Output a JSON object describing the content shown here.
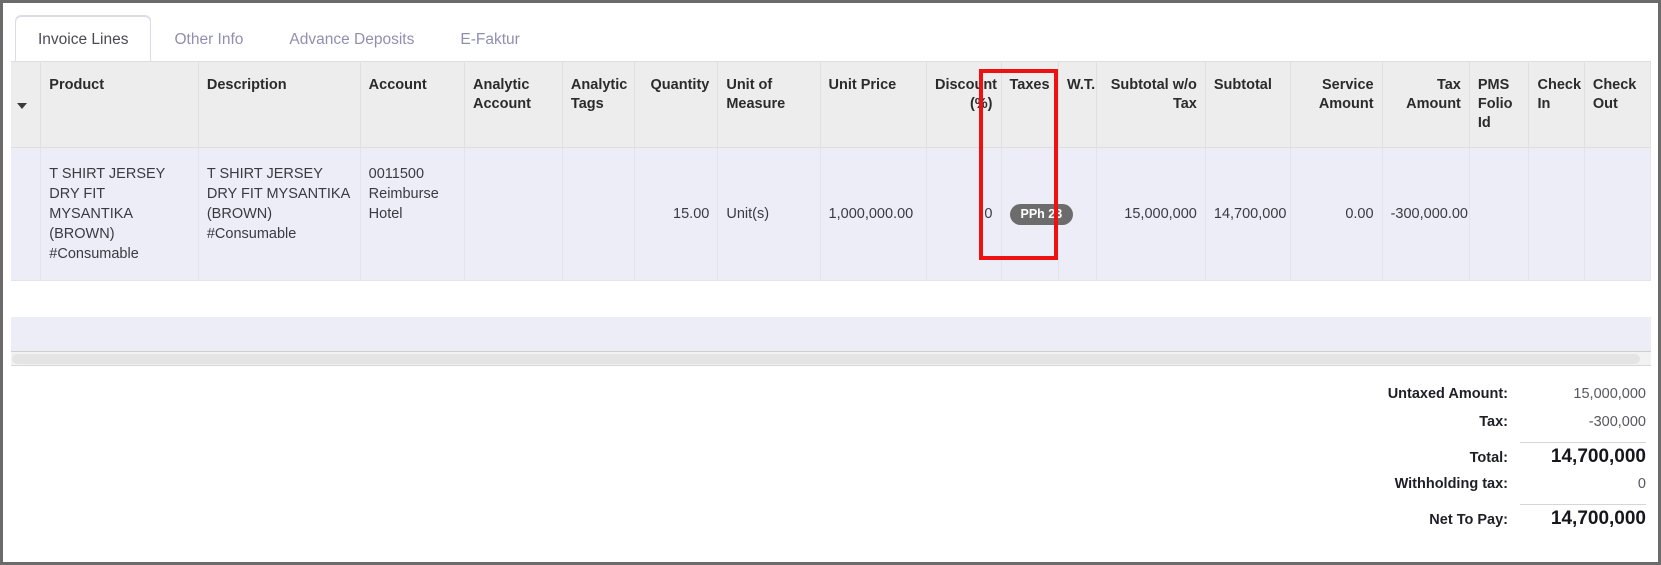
{
  "tabs": [
    {
      "label": "Invoice Lines",
      "active": true
    },
    {
      "label": "Other Info",
      "active": false
    },
    {
      "label": "Advance Deposits",
      "active": false
    },
    {
      "label": "E-Faktur",
      "active": false
    }
  ],
  "table": {
    "sort_icon": "caret-down-icon",
    "columns": [
      {
        "label": "Product",
        "align": "left"
      },
      {
        "label": "Description",
        "align": "left"
      },
      {
        "label": "Account",
        "align": "left"
      },
      {
        "label": "Analytic Account",
        "align": "left"
      },
      {
        "label": "Analytic Tags",
        "align": "left"
      },
      {
        "label": "Quantity",
        "align": "right"
      },
      {
        "label": "Unit of Measure",
        "align": "left"
      },
      {
        "label": "Unit Price",
        "align": "left"
      },
      {
        "label": "Discount (%)",
        "align": "right"
      },
      {
        "label": "Taxes",
        "align": "left"
      },
      {
        "label": "W.T.",
        "align": "left"
      },
      {
        "label": "Subtotal w/o Tax",
        "align": "right"
      },
      {
        "label": "Subtotal",
        "align": "left"
      },
      {
        "label": "Service Amount",
        "align": "right"
      },
      {
        "label": "Tax Amount",
        "align": "right"
      },
      {
        "label": "PMS Folio Id",
        "align": "left"
      },
      {
        "label": "Check In",
        "align": "left"
      },
      {
        "label": "Check Out",
        "align": "left"
      }
    ],
    "rows": [
      {
        "product": "T SHIRT JERSEY DRY FIT MYSANTIKA (BROWN) #Consumable",
        "description": "T SHIRT JERSEY DRY FIT MYSANTIKA (BROWN) #Consumable",
        "account": "0011500 Reimburse Hotel",
        "analytic_account": "",
        "analytic_tags": "",
        "quantity": "15.00",
        "unit_of_measure": "Unit(s)",
        "unit_price": "1,000,000.00",
        "discount": "0",
        "taxes": "PPh 23",
        "wt": "",
        "subtotal_wo_tax": "15,000,000",
        "subtotal": "14,700,000",
        "service_amount": "0.00",
        "tax_amount": "-300,000.00",
        "pms_folio_id": "",
        "check_in": "",
        "check_out": ""
      }
    ]
  },
  "highlight": {
    "name": "taxes-column-highlight",
    "color": "#ee1111"
  },
  "totals": [
    {
      "label": "Untaxed Amount:",
      "value": "15,000,000",
      "emphasis": false
    },
    {
      "label": "Tax:",
      "value": "-300,000",
      "emphasis": false
    },
    {
      "label": "Total:",
      "value": "14,700,000",
      "emphasis": true
    },
    {
      "label": "Withholding tax:",
      "value": "0",
      "emphasis": false
    },
    {
      "label": "Net To Pay:",
      "value": "14,700,000",
      "emphasis": true
    }
  ]
}
